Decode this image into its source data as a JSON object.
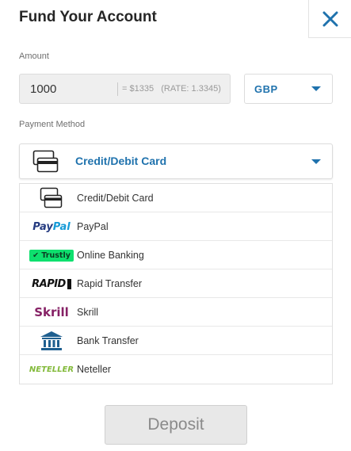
{
  "header": {
    "title": "Fund Your Account"
  },
  "amount": {
    "label": "Amount",
    "value": "1000",
    "conversion": "= $1335",
    "rate": "(RATE: 1.3345)"
  },
  "currency": {
    "selected": "GBP"
  },
  "payment_method": {
    "label": "Payment Method",
    "selected": "Credit/Debit Card",
    "options": [
      {
        "logo": "card-icon",
        "label": "Credit/Debit Card"
      },
      {
        "logo": "paypal-logo",
        "logo_text_a": "Pay",
        "logo_text_b": "Pal",
        "label": "PayPal"
      },
      {
        "logo": "trustly-logo",
        "logo_text": "Trustly",
        "label": "Online Banking"
      },
      {
        "logo": "rapid-logo",
        "logo_text": "RAPID",
        "label": "Rapid Transfer"
      },
      {
        "logo": "skrill-logo",
        "logo_text": "Skrill",
        "label": "Skrill"
      },
      {
        "logo": "bank-icon",
        "label": "Bank Transfer"
      },
      {
        "logo": "neteller-logo",
        "logo_text": "NETELLER",
        "label": "Neteller"
      }
    ]
  },
  "deposit_button": {
    "label": "Deposit"
  },
  "colors": {
    "accent": "#1f72ad",
    "paypal_dark": "#253b80",
    "paypal_light": "#179bd7",
    "trustly": "#0ee06e",
    "skrill": "#862165",
    "neteller": "#83ba3b"
  }
}
